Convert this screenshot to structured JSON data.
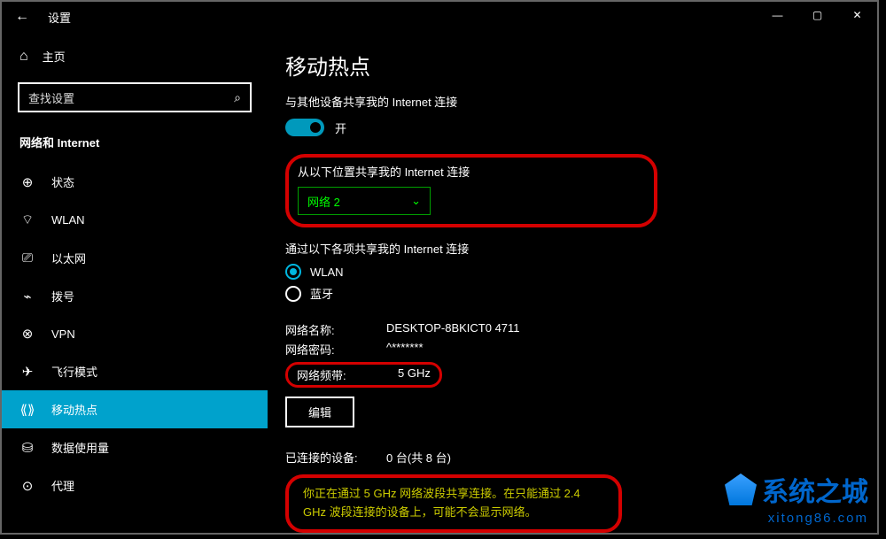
{
  "titlebar": {
    "title": "设置",
    "back_icon": "←"
  },
  "win": {
    "min": "—",
    "max": "▢",
    "close": "✕"
  },
  "sidebar": {
    "home": "主页",
    "search_placeholder": "查找设置",
    "category": "网络和 Internet",
    "items": [
      {
        "icon": "⊕",
        "label": "状态"
      },
      {
        "icon": "⌔",
        "label": "WLAN"
      },
      {
        "icon": "⎚",
        "label": "以太网"
      },
      {
        "icon": "⌁",
        "label": "拨号"
      },
      {
        "icon": "⊗",
        "label": "VPN"
      },
      {
        "icon": "✈",
        "label": "飞行模式"
      },
      {
        "icon": "⟪⟫",
        "label": "移动热点"
      },
      {
        "icon": "⛁",
        "label": "数据使用量"
      },
      {
        "icon": "⊙",
        "label": "代理"
      }
    ]
  },
  "main": {
    "page_title": "移动热点",
    "share_label": "与其他设备共享我的 Internet 连接",
    "toggle_state": "开",
    "share_from_label": "从以下位置共享我的 Internet 连接",
    "share_from_value": "网络 2",
    "share_via_label": "通过以下各项共享我的 Internet 连接",
    "radio_wlan": "WLAN",
    "radio_bt": "蓝牙",
    "net_name_label": "网络名称:",
    "net_name_value": "DESKTOP-8BKICT0 4711",
    "net_pwd_label": "网络密码:",
    "net_pwd_value": "^*******",
    "band_label": "网络频带:",
    "band_value": "5 GHz",
    "edit": "编辑",
    "devices_label": "已连接的设备:",
    "devices_value": "0 台(共 8 台)",
    "warning": "你正在通过 5 GHz 网络波段共享连接。在只能通过 2.4 GHz 波段连接的设备上，可能不会显示网络。"
  },
  "watermark": {
    "title": "系统之城",
    "url": "xitong86.com"
  }
}
